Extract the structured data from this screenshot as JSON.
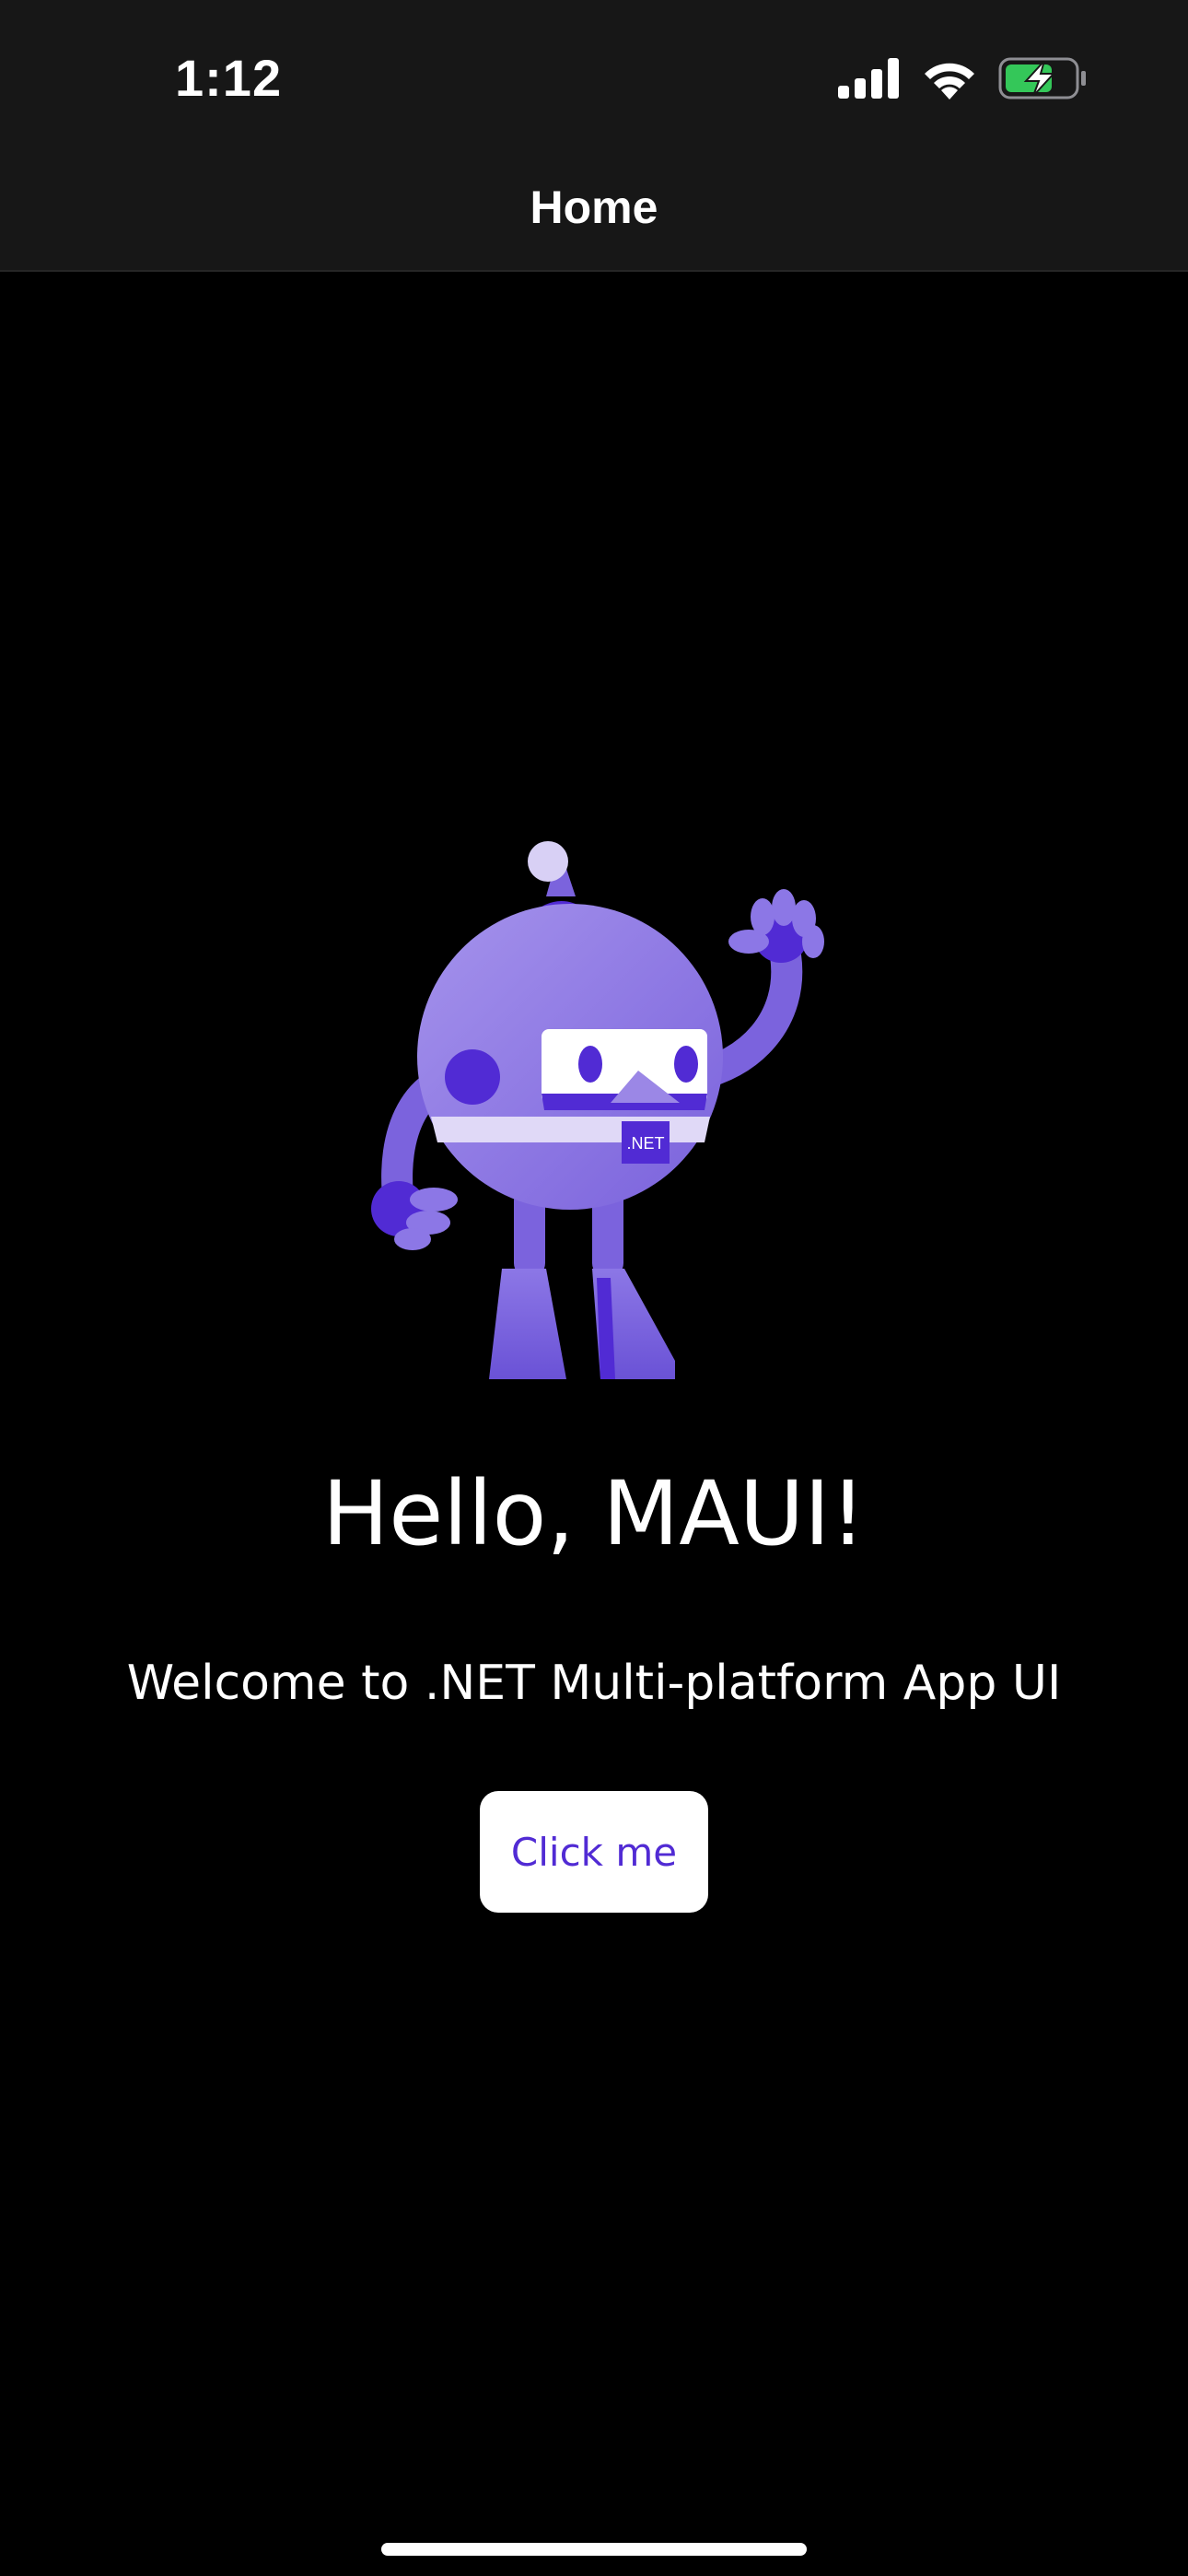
{
  "status_bar": {
    "time": "1:12",
    "icons": [
      "signal-icon",
      "wifi-icon",
      "battery-charging-icon"
    ]
  },
  "nav": {
    "title": "Home"
  },
  "main": {
    "image_name": "dotnet-bot-icon",
    "image_badge": ".NET",
    "headline": "Hello, MAUI!",
    "subheadline": "Welcome to .NET Multi-platform App UI",
    "button_label": "Click me"
  },
  "colors": {
    "primary": "#512bd4",
    "bot_light": "#9b87e6",
    "bot_mid": "#7b63dd",
    "battery_green": "#34c759",
    "nav_background": "#171717",
    "page_background": "#000000"
  }
}
